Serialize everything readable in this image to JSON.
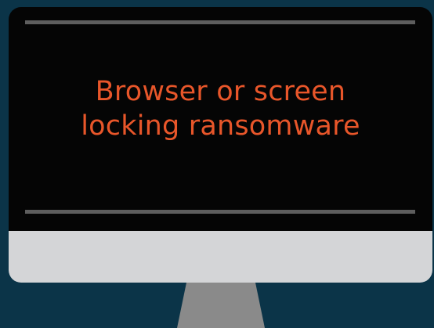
{
  "monitor": {
    "headline_lines": [
      "Browser or screen",
      "locking ransomware"
    ]
  },
  "colors": {
    "background": "#0b3448",
    "screen": "#050505",
    "bezel_line": "#5e5e5e",
    "chin": "#d4d5d7",
    "stand": "#8a8a8a",
    "headline": "#e8562a"
  },
  "icons": [
    "monitor-icon"
  ]
}
